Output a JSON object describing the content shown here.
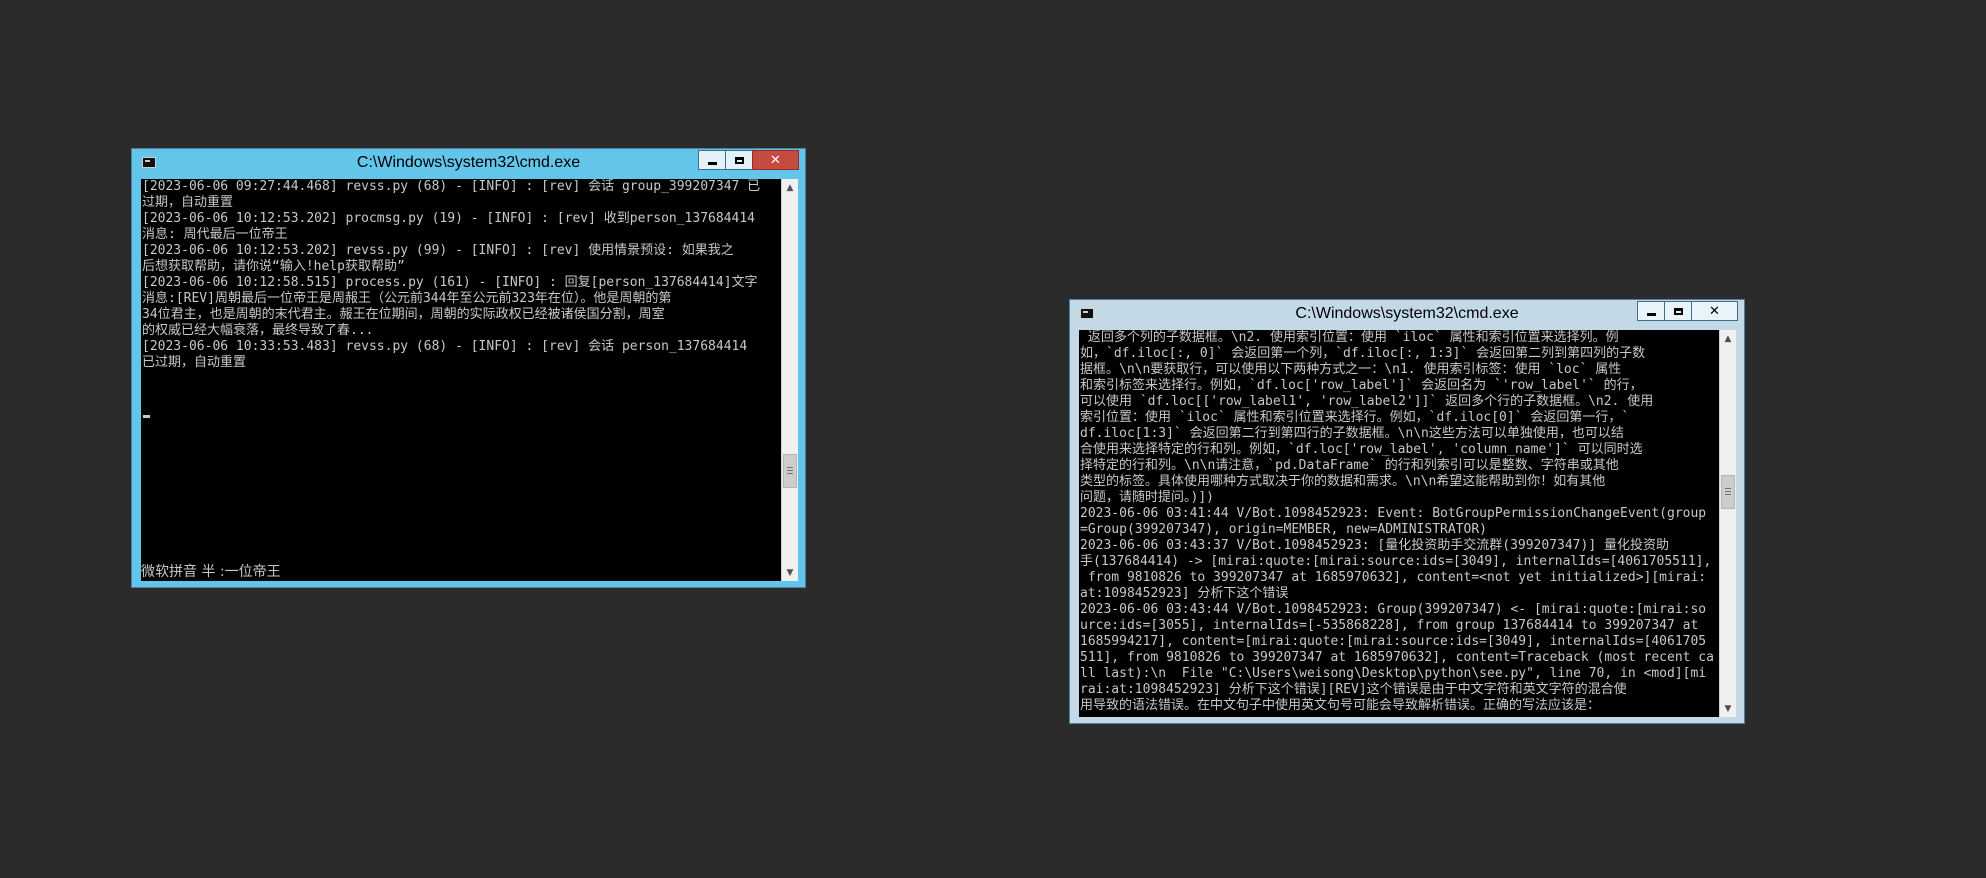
{
  "windows": {
    "left": {
      "title": "C:\\Windows\\system32\\cmd.exe",
      "close_glyph": "✕",
      "lines": [
        "[2023-06-06 09:27:44.468] revss.py (68) - [INFO] : [rev] 会话 group_399207347 已",
        "过期，自动重置",
        "[2023-06-06 10:12:53.202] procmsg.py (19) - [INFO] : [rev] 收到person_137684414",
        "消息: 周代最后一位帝王",
        "[2023-06-06 10:12:53.202] revss.py (99) - [INFO] : [rev] 使用情景预设: 如果我之",
        "后想获取帮助，请你说“输入!help获取帮助”",
        "[2023-06-06 10:12:58.515] process.py (161) - [INFO] : 回复[person_137684414]文字",
        "消息:[REV]周朝最后一位帝王是周赧王（公元前344年至公元前323年在位）。他是周朝的第",
        "34位君主，也是周朝的末代君主。赧王在位期间，周朝的实际政权已经被诸侯国分割，周室",
        "的权威已经大幅衰落，最终导致了春...",
        "[2023-06-06 10:33:53.483] revss.py (68) - [INFO] : [rev] 会话 person_137684414",
        "已过期，自动重置"
      ],
      "ime_bar": "微软拼音 半 :一位帝王"
    },
    "right": {
      "title": "C:\\Windows\\system32\\cmd.exe",
      "close_glyph": "✕",
      "lines": [
        " 返回多个列的子数据框。\\n2. 使用索引位置：使用 `iloc` 属性和索引位置来选择列。例",
        "如，`df.iloc[:, 0]` 会返回第一个列，`df.iloc[:, 1:3]` 会返回第二列到第四列的子数",
        "据框。\\n\\n要获取行，可以使用以下两种方式之一：\\n1. 使用索引标签：使用 `loc` 属性",
        "和索引标签来选择行。例如，`df.loc['row_label']` 会返回名为 `'row_label'` 的行，",
        "可以使用 `df.loc[['row_label1', 'row_label2']]` 返回多个行的子数据框。\\n2. 使用",
        "索引位置：使用 `iloc` 属性和索引位置来选择行。例如，`df.iloc[0]` 会返回第一行，`",
        "df.iloc[1:3]` 会返回第二行到第四行的子数据框。\\n\\n这些方法可以单独使用，也可以结",
        "合使用来选择特定的行和列。例如，`df.loc['row_label', 'column_name']` 可以同时选",
        "择特定的行和列。\\n\\n请注意，`pd.DataFrame` 的行和列索引可以是整数、字符串或其他",
        "类型的标签。具体使用哪种方式取决于你的数据和需求。\\n\\n希望这能帮助到你！如有其他",
        "问题，请随时提问。)])",
        "2023-06-06 03:41:44 V/Bot.1098452923: Event: BotGroupPermissionChangeEvent(group",
        "=Group(399207347), origin=MEMBER, new=ADMINISTRATOR)",
        "2023-06-06 03:43:37 V/Bot.1098452923: [量化投资助手交流群(399207347)] 量化投资助",
        "手(137684414) -> [mirai:quote:[mirai:source:ids=[3049], internalIds=[4061705511],",
        " from 9810826 to 399207347 at 1685970632], content=<not yet initialized>][mirai:",
        "at:1098452923] 分析下这个错误",
        "2023-06-06 03:43:44 V/Bot.1098452923: Group(399207347) <- [mirai:quote:[mirai:so",
        "urce:ids=[3055], internalIds=[-535868228], from group 137684414 to 399207347 at",
        "1685994217], content=[mirai:quote:[mirai:source:ids=[3049], internalIds=[4061705",
        "511], from 9810826 to 399207347 at 1685970632], content=Traceback (most recent ca",
        "ll last):\\n  File \"C:\\Users\\weisong\\Desktop\\python\\see.py\", line 70, in <mod][mi",
        "rai:at:1098452923] 分析下这个错误][REV]这个错误是由于中文字符和英文字符的混合使",
        "用导致的语法错误。在中文句子中使用英文句号可能会导致解析错误。正确的写法应该是："
      ]
    }
  },
  "colors": {
    "desktop": "#2b2b2b",
    "active_frame": "#62c5e9",
    "inactive_frame": "#c3dae6",
    "close_active": "#c74a40",
    "console_bg": "#000000",
    "console_text": "#c8c8c8"
  },
  "icons": {
    "window_icon": "console-window-icon",
    "minimize": "minimize-icon",
    "maximize": "maximize-icon",
    "close": "close-icon",
    "scroll_up": "arrow-up-icon",
    "scroll_down": "arrow-down-icon"
  }
}
